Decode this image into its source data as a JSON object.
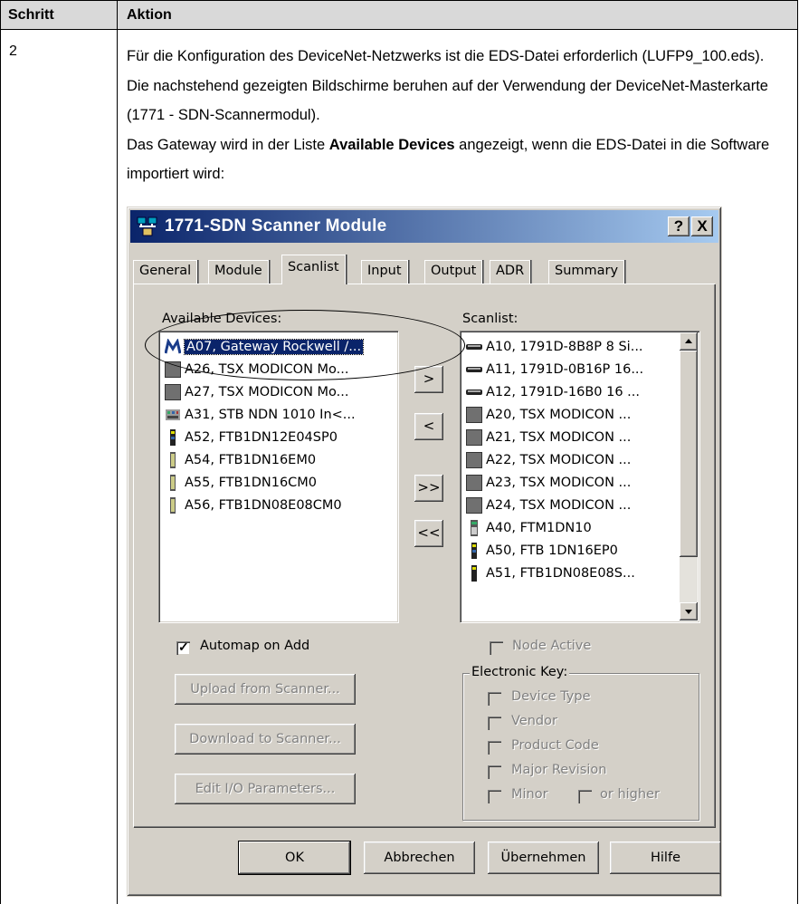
{
  "table": {
    "col_step_header": "Schritt",
    "col_action_header": "Aktion",
    "step_number": "2",
    "para1": "Für die Konfiguration des DeviceNet-Netzwerks ist die EDS-Datei erforderlich (LUFP9_100.eds).",
    "para2": "Die nachstehend gezeigten Bildschirme beruhen auf der Verwendung der DeviceNet-Masterkarte (1771 - SDN-Scannermodul).",
    "para3_before": "Das Gateway wird in der Liste ",
    "para3_bold": "Available Devices",
    "para3_after": " angezeigt, wenn die EDS-Datei in die Software importiert wird:"
  },
  "dialog": {
    "title": "1771-SDN Scanner Module",
    "help_button": "?",
    "close_button": "X",
    "tabs": [
      "General",
      "Module",
      "Scanlist",
      "Input",
      "Output",
      "ADR",
      "Summary"
    ],
    "active_tab": "Scanlist",
    "available_label": "Available Devices:",
    "scanlist_label": "Scanlist:",
    "available_devices": [
      "A07, Gateway Rockwell /...",
      "A26, TSX MODICON Mo...",
      "A27, TSX MODICON Mo...",
      "A31, STB NDN 1010 In<...",
      "A52, FTB1DN12E04SP0",
      "A54, FTB1DN16EM0",
      "A55, FTB1DN16CM0",
      "A56, FTB1DN08E08CM0"
    ],
    "scanlist_devices": [
      "A10, 1791D-8B8P 8 Si...",
      "A11, 1791D-0B16P 16...",
      "A12, 1791D-16B0 16 ...",
      "A20, TSX MODICON ...",
      "A21, TSX MODICON ...",
      "A22, TSX MODICON ...",
      "A23, TSX MODICON ...",
      "A24, TSX MODICON ...",
      "A40, FTM1DN10",
      "A50, FTB 1DN16EP0",
      "A51, FTB1DN08E08S..."
    ],
    "move_buttons": [
      ">",
      "<",
      ">>",
      "<<"
    ],
    "automap_label": "Automap on Add",
    "automap_checked": true,
    "node_active_label": "Node Active",
    "upload_button": "Upload from Scanner...",
    "download_button": "Download to Scanner...",
    "edit_io_button": "Edit I/O Parameters...",
    "electronic_key_title": "Electronic Key:",
    "key_device_type": "Device Type",
    "key_vendor": "Vendor",
    "key_product_code": "Product Code",
    "key_major_revision": "Major Revision",
    "key_minor": "Minor",
    "key_or_higher": "or higher",
    "ok_button": "OK",
    "cancel_button": "Abbrechen",
    "apply_button": "Übernehmen",
    "help_bottom_button": "Hilfe"
  }
}
